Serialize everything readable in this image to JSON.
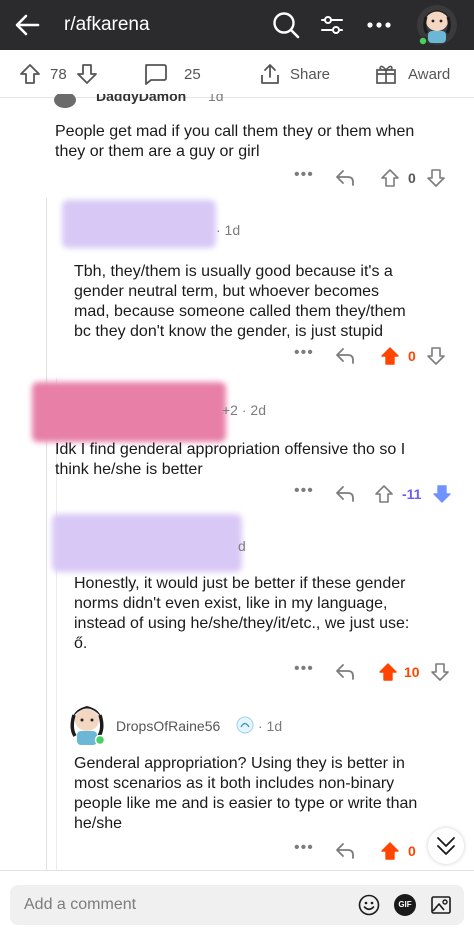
{
  "header": {
    "subreddit": "r/afkarena",
    "icons": [
      "back-arrow-icon",
      "search-icon",
      "filter-icon",
      "more-icon",
      "avatar"
    ]
  },
  "post_actions": {
    "upvotes": "78",
    "comments": "25",
    "share_label": "Share",
    "award_label": "Award"
  },
  "comments": [
    {
      "author_partial": "DaddyDamon",
      "age_partial": "1d",
      "text_lines": [
        "People get mad if you call them they or them when",
        "they or them are a guy or girl"
      ],
      "score": "0",
      "vote": "none"
    },
    {
      "age": "· 1d",
      "text_lines": [
        "Tbh, they/them is usually good because it's a",
        "gender neutral term, but whoever becomes",
        "mad, because someone called them they/them",
        "bc they don't know the gender, is just stupid"
      ],
      "score": "0",
      "vote": "up"
    },
    {
      "age": "+2 · 2d",
      "text_lines": [
        "Idk I find genderal appropriation offensive tho so I",
        "think he/she is better"
      ],
      "score": "-11",
      "vote": "down"
    },
    {
      "age": "d",
      "text_lines": [
        "Honestly, it would just be better if these gender",
        "norms didn't even exist, like in my language,",
        "instead of using he/she/they/it/etc., we just use:",
        "ő."
      ],
      "score": "10",
      "vote": "up"
    },
    {
      "author": "DropsOfRaine56",
      "age": "· 1d",
      "text_lines": [
        "Genderal appropriation? Using they is better in",
        "most scenarios as it both includes non-binary",
        "people like me and is easier to type or write than",
        "he/she"
      ],
      "score": "0",
      "vote": "up"
    }
  ],
  "composer": {
    "placeholder": "Add a comment",
    "gif_label": "GIF"
  },
  "colors": {
    "upvote": "#ff4500",
    "downvote": "#7193ff",
    "topbar": "#2b2b2d",
    "redact_purple": "#d8c8f6",
    "redact_pink": "#e77fa6"
  }
}
